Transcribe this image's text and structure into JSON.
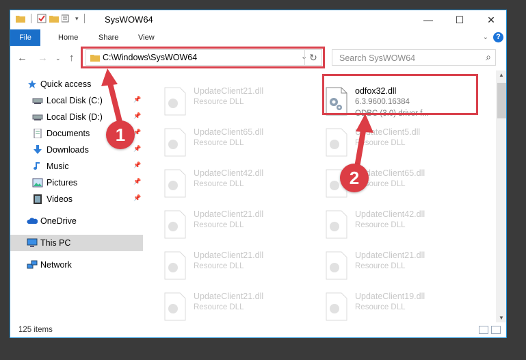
{
  "window": {
    "title": "SysWOW64",
    "controls": {
      "minimize": "—",
      "maximize": "☐",
      "close": "✕"
    }
  },
  "ribbon": {
    "tabs": [
      "File",
      "Home",
      "Share",
      "View"
    ],
    "expand_glyph": "⌄",
    "help_glyph": "?"
  },
  "address": {
    "path": "C:\\Windows\\SysWOW64",
    "dropdown_glyph": "⌄",
    "refresh_glyph": "↻"
  },
  "search": {
    "placeholder": "Search SysWOW64"
  },
  "sidebar": {
    "items": [
      {
        "label": "Quick access",
        "icon": "star-icon"
      },
      {
        "label": "Local Disk (C:)",
        "icon": "drive-icon",
        "pinned": true
      },
      {
        "label": "Local Disk (D:)",
        "icon": "drive-icon",
        "pinned": true
      },
      {
        "label": "Documents",
        "icon": "documents-icon",
        "pinned": true
      },
      {
        "label": "Downloads",
        "icon": "downloads-icon",
        "pinned": true
      },
      {
        "label": "Music",
        "icon": "music-icon",
        "pinned": true
      },
      {
        "label": "Pictures",
        "icon": "pictures-icon",
        "pinned": true
      },
      {
        "label": "Videos",
        "icon": "videos-icon",
        "pinned": true
      },
      {
        "label": "OneDrive",
        "icon": "cloud-icon"
      },
      {
        "label": "This PC",
        "icon": "computer-icon",
        "selected": true
      },
      {
        "label": "Network",
        "icon": "network-icon"
      }
    ]
  },
  "files": {
    "left": [
      {
        "name": "UpdateClient21.dll",
        "type": "Resource DLL"
      },
      {
        "name": "UpdateClient65.dll",
        "type": "Resource DLL"
      },
      {
        "name": "UpdateClient42.dll",
        "type": "Resource DLL"
      },
      {
        "name": "UpdateClient21.dll",
        "type": "Resource DLL"
      },
      {
        "name": "UpdateClient21.dll",
        "type": "Resource DLL"
      },
      {
        "name": "UpdateClient21.dll",
        "type": "Resource DLL"
      }
    ],
    "highlighted": {
      "name": "odfox32.dll",
      "version": "6.3.9600.16384",
      "description": "ODBC (3.0) driver f..."
    },
    "right": [
      {
        "name": "UpdateClient5.dll",
        "type": "Resource DLL"
      },
      {
        "name": "UpdateClient65.dll",
        "type": "Resource DLL"
      },
      {
        "name": "UpdateClient42.dll",
        "type": "Resource DLL"
      },
      {
        "name": "UpdateClient21.dll",
        "type": "Resource DLL"
      },
      {
        "name": "UpdateClient19.dll",
        "type": "Resource DLL"
      }
    ]
  },
  "status": {
    "item_count": "125 items"
  },
  "annotations": {
    "step1": "1",
    "step2": "2",
    "color": "#d9414c"
  }
}
